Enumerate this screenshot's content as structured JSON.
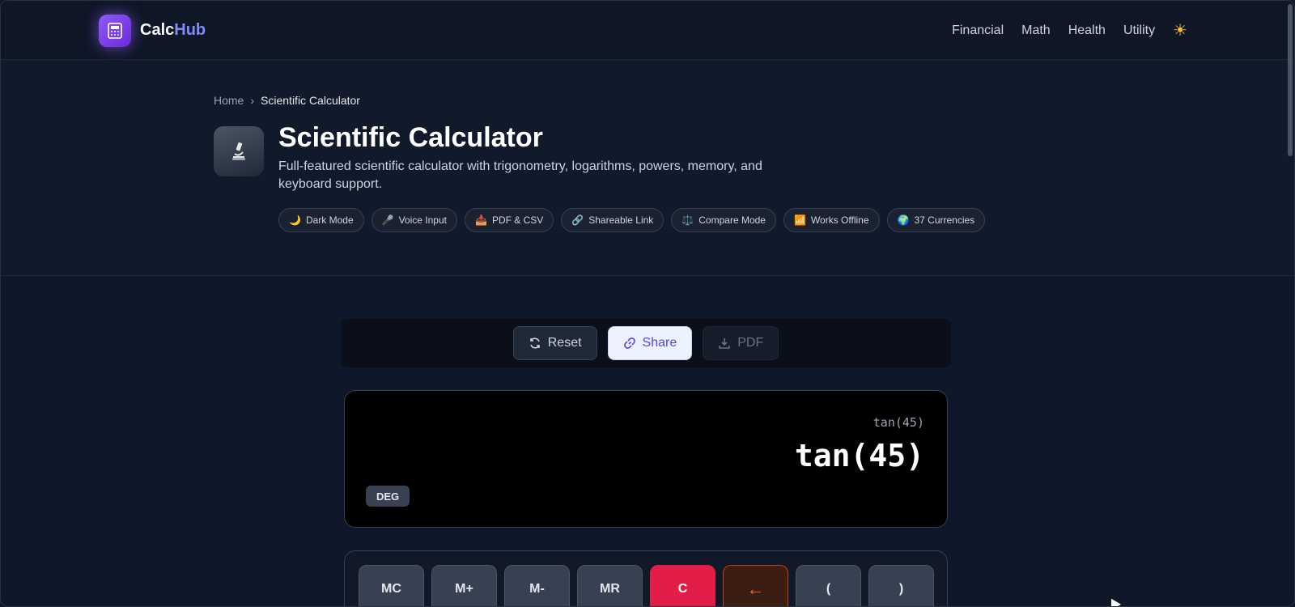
{
  "brand": {
    "name_part1": "Calc",
    "name_part2": "Hub"
  },
  "nav": {
    "items": [
      {
        "label": "Financial"
      },
      {
        "label": "Math"
      },
      {
        "label": "Health"
      },
      {
        "label": "Utility"
      }
    ],
    "theme_icon": "sun-icon"
  },
  "breadcrumb": {
    "home": "Home",
    "separator": "›",
    "current": "Scientific Calculator"
  },
  "hero": {
    "icon": "microscope-icon",
    "title": "Scientific Calculator",
    "description": "Full-featured scientific calculator with trigonometry, logarithms, powers, memory, and keyboard support."
  },
  "features": [
    {
      "icon": "🌙",
      "label": "Dark Mode"
    },
    {
      "icon": "🎤",
      "label": "Voice Input"
    },
    {
      "icon": "📥",
      "label": "PDF & CSV"
    },
    {
      "icon": "🔗",
      "label": "Shareable Link"
    },
    {
      "icon": "⚖️",
      "label": "Compare Mode"
    },
    {
      "icon": "📶",
      "label": "Works Offline"
    },
    {
      "icon": "🌍",
      "label": "37 Currencies"
    }
  ],
  "toolbar": {
    "reset_label": "Reset",
    "share_label": "Share",
    "pdf_label": "PDF"
  },
  "display": {
    "expression": "tan(45)",
    "value": "tan(45)",
    "angle_mode": "DEG"
  },
  "keypad": {
    "row1": [
      "MC",
      "M+",
      "M-",
      "MR",
      "C",
      "←",
      "(",
      ")"
    ]
  },
  "colors": {
    "accent": "#818cf8",
    "clear_key": "#e11d48",
    "backspace_key": "#f97316",
    "share_bg": "#eef2ff"
  }
}
